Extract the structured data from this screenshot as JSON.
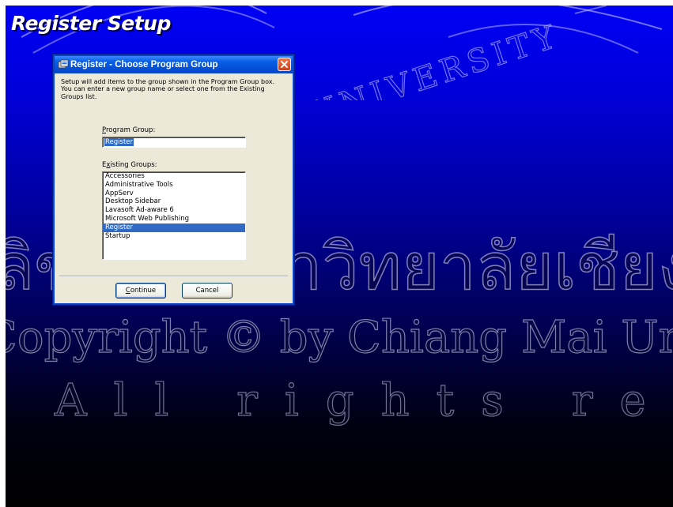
{
  "page": {
    "title": "Register Setup"
  },
  "dialog": {
    "title": "Register - Choose Program Group",
    "description": "Setup will add items to the group shown in the Program Group box. You can enter a new group name or select one from the Existing Groups list.",
    "program_group": {
      "label_mnemonic": "P",
      "label_rest": "rogram Group:",
      "value": "Register"
    },
    "existing_groups": {
      "label_first": "E",
      "label_mnemonic": "x",
      "label_rest": "isting Groups:",
      "items": [
        "Accessories",
        "Administrative Tools",
        "AppServ",
        "Desktop Sidebar",
        "Lavasoft Ad-aware 6",
        "Microsoft Web Publishing",
        "Register",
        "Startup"
      ],
      "selected": "Register"
    },
    "buttons": {
      "continue_mnemonic": "C",
      "continue_rest": "ontinue",
      "cancel": "Cancel"
    }
  },
  "watermark": {
    "thai": "ลิขสิทธิ์มหาวิทยาลัยเชียงใหม่",
    "copyright": "Copyright © by Chiang Mai University",
    "rights": "All rights reserved"
  },
  "colors": {
    "gradient_top": "#0000f4",
    "gradient_bottom": "#000000",
    "titlebar": "#0450d8",
    "selection": "#316ac5",
    "dialog_face": "#ece9d8"
  }
}
